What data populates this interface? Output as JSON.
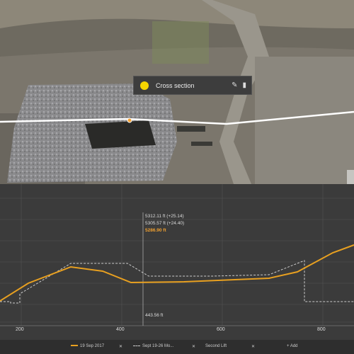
{
  "popup": {
    "title": "Cross section",
    "edit_icon": "pencil-icon",
    "delete_icon": "trash-icon",
    "color": "#f5d400"
  },
  "profile": {
    "x_ticks": [
      "200",
      "400",
      "600",
      "800"
    ],
    "hover": {
      "line1": "5312.11 ft (+25.14)",
      "line2": "5305.57 ft (+24.40)",
      "line3": "5286.90 ft",
      "distance": "443.56 ft"
    }
  },
  "legend": {
    "series1": "19 Sep 2017",
    "series2": "Sept 19-26 Mo...",
    "series3": "Second Lift",
    "add": "Add",
    "remove_icon": "x-icon"
  },
  "colors": {
    "series1": "#e8a020",
    "series2": "#cccccc",
    "highlight": "#f0a030"
  }
}
